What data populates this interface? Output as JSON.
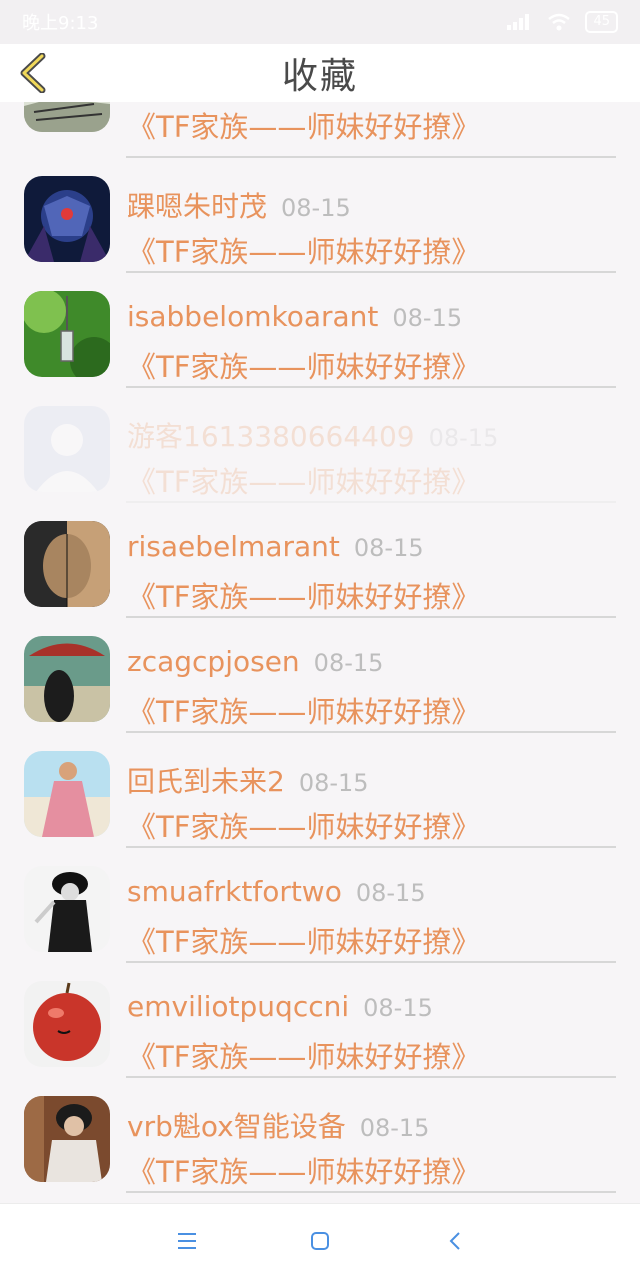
{
  "status_bar": {
    "time": "晚上9:13",
    "battery": "45"
  },
  "header": {
    "title": "收藏"
  },
  "items": [
    {
      "name": "",
      "date": "",
      "book": "《TF家族——师妹好好撩》"
    },
    {
      "name": "踝嗯朱时茂",
      "date": "08-15",
      "book": "《TF家族——师妹好好撩》"
    },
    {
      "name": "isabbelomkoarant",
      "date": "08-15",
      "book": "《TF家族——师妹好好撩》"
    },
    {
      "name": "游客1613380664409",
      "date": "08-15",
      "book": "《TF家族——师妹好好撩》"
    },
    {
      "name": "risaebelmarant",
      "date": "08-15",
      "book": "《TF家族——师妹好好撩》"
    },
    {
      "name": "zcagcpjosen",
      "date": "08-15",
      "book": "《TF家族——师妹好好撩》"
    },
    {
      "name": "回氏到未来2",
      "date": "08-15",
      "book": "《TF家族——师妹好好撩》"
    },
    {
      "name": "smuafrktfortwo",
      "date": "08-15",
      "book": "《TF家族——师妹好好撩》"
    },
    {
      "name": "emviliotpuqccni",
      "date": "08-15",
      "book": "《TF家族——师妹好好撩》"
    },
    {
      "name": "vrb魁ox智能设备",
      "date": "08-15",
      "book": "《TF家族——师妹好好撩》"
    }
  ],
  "colors": {
    "accent": "#e8935d",
    "date": "#bdbdbd",
    "divider": "#d7d7d7"
  }
}
